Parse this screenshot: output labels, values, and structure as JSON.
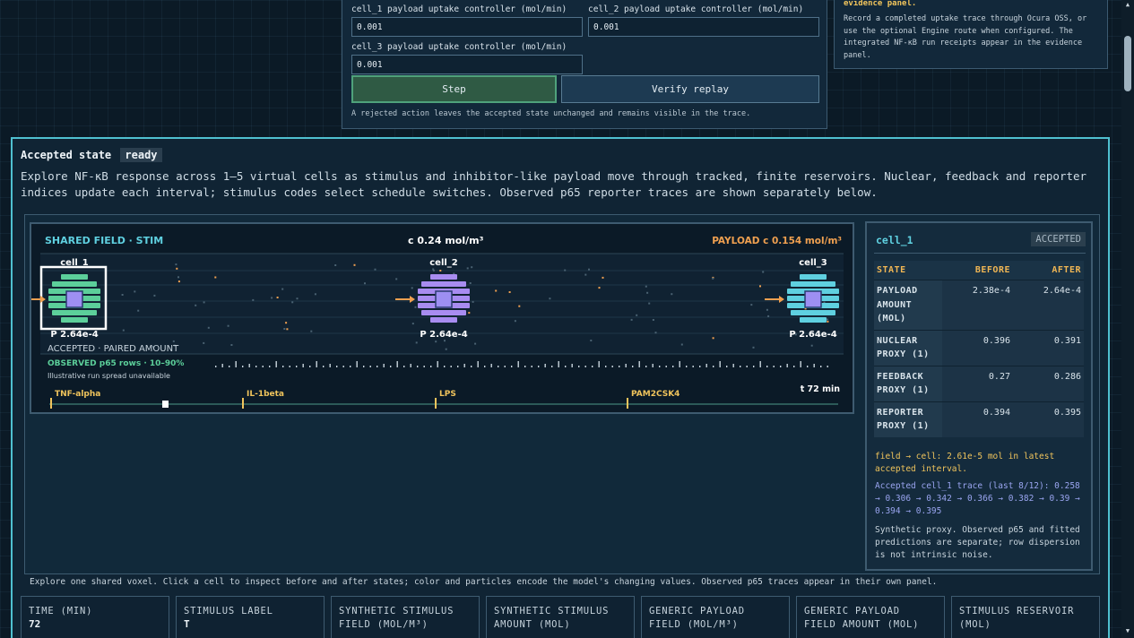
{
  "controls": {
    "cell1_label": "cell_1 payload uptake controller (mol/min)",
    "cell1_value": "0.001",
    "cell2_label": "cell_2 payload uptake controller (mol/min)",
    "cell2_value": "0.001",
    "cell3_label": "cell_3 payload uptake controller (mol/min)",
    "cell3_value": "0.001",
    "step_label": "Step",
    "verify_label": "Verify replay",
    "note": "A rejected action leaves the accepted state unchanged and remains visible in the trace."
  },
  "evidence": {
    "title": "evidence panel.",
    "text": "Record a completed uptake trace through Ocura OSS, or use the optional Engine route when configured. The integrated NF-κB run receipts appear in the evidence panel."
  },
  "main": {
    "heading": "Accepted state",
    "status": "ready",
    "description": "Explore NF-κB response across 1–5 virtual cells as stimulus and inhibitor-like payload move through tracked, finite reservoirs. Nuclear, feedback and reporter indices update each interval; stimulus codes select schedule switches. Observed p65 reporter traces are shown separately below.",
    "caption": "Explore one shared voxel. Click a cell to inspect before and after states; color and particles encode the model's changing values. Observed p65 traces appear in their own panel."
  },
  "viz": {
    "field_label": "SHARED FIELD · STIM",
    "concentration": "c 0.24 mol/m³",
    "payload_concentration": "PAYLOAD c 0.154 mol/m³",
    "cells": [
      {
        "name": "cell_1",
        "payload": "P 2.64e-4",
        "color": "#5ccf9a",
        "selected": true
      },
      {
        "name": "cell_2",
        "payload": "P 2.64e-4",
        "color": "#a88cf0",
        "selected": false
      },
      {
        "name": "cell_3",
        "payload": "P 2.64e-4",
        "color": "#5fd0e0",
        "selected": false
      }
    ],
    "accepted_note": "ACCEPTED · PAIRED AMOUNT",
    "observed_label": "OBSERVED p65 rows · 10–90%",
    "spread_note": "Illustrative run spread unavailable",
    "time_label": "t 72 min",
    "stimuli": [
      "TNF-alpha",
      "IL-1beta",
      "LPS",
      "PAM2CSK4"
    ],
    "accent_orange": "#f0a050",
    "accent_yellow": "#f0c45c"
  },
  "inspector": {
    "cell": "cell_1",
    "status": "ACCEPTED",
    "columns": [
      "STATE",
      "BEFORE",
      "AFTER"
    ],
    "rows": [
      {
        "label": "PAYLOAD AMOUNT (MOL)",
        "before": "2.38e-4",
        "after": "2.64e-4"
      },
      {
        "label": "NUCLEAR PROXY (1)",
        "before": "0.396",
        "after": "0.391"
      },
      {
        "label": "FEEDBACK PROXY (1)",
        "before": "0.27",
        "after": "0.286"
      },
      {
        "label": "REPORTER PROXY (1)",
        "before": "0.394",
        "after": "0.395"
      }
    ],
    "flux": "field → cell: 2.61e-5 mol in latest accepted interval.",
    "trace": "Accepted cell_1 trace (last 8/12): 0.258 → 0.306 → 0.342 → 0.366 → 0.382 → 0.39 → 0.394 → 0.395",
    "note": "Synthetic proxy. Observed p65 and fitted predictions are separate; row dispersion is not intrinsic noise."
  },
  "metrics": [
    {
      "label": "TIME (MIN)",
      "value": "72"
    },
    {
      "label": "STIMULUS LABEL",
      "value": "T"
    },
    {
      "label": "SYNTHETIC STIMULUS FIELD (MOL/M³)",
      "value": ""
    },
    {
      "label": "SYNTHETIC STIMULUS AMOUNT (MOL)",
      "value": ""
    },
    {
      "label": "GENERIC PAYLOAD FIELD (MOL/M³)",
      "value": ""
    },
    {
      "label": "GENERIC PAYLOAD FIELD AMOUNT (MOL)",
      "value": ""
    },
    {
      "label": "STIMULUS RESERVOIR (MOL)",
      "value": ""
    }
  ]
}
